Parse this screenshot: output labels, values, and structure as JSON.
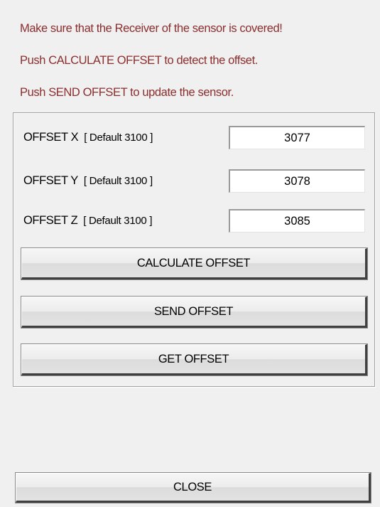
{
  "instructions": [
    "Make sure that the Receiver of the sensor is covered!",
    "Push CALCULATE OFFSET to detect the offset.",
    "Push SEND OFFSET to update the sensor."
  ],
  "offsets": [
    {
      "label": "OFFSET X",
      "default": "[ Default 3100 ]",
      "value": "3077"
    },
    {
      "label": "OFFSET Y",
      "default": "[ Default 3100 ]",
      "value": "3078"
    },
    {
      "label": "OFFSET Z",
      "default": "[ Default 3100 ]",
      "value": "3085"
    }
  ],
  "buttons": {
    "calculate": "CALCULATE OFFSET",
    "send": "SEND OFFSET",
    "get": "GET OFFSET",
    "close": "CLOSE"
  },
  "colors": {
    "instruction_text": "#8b2e2e",
    "background": "#f0f0f0"
  }
}
